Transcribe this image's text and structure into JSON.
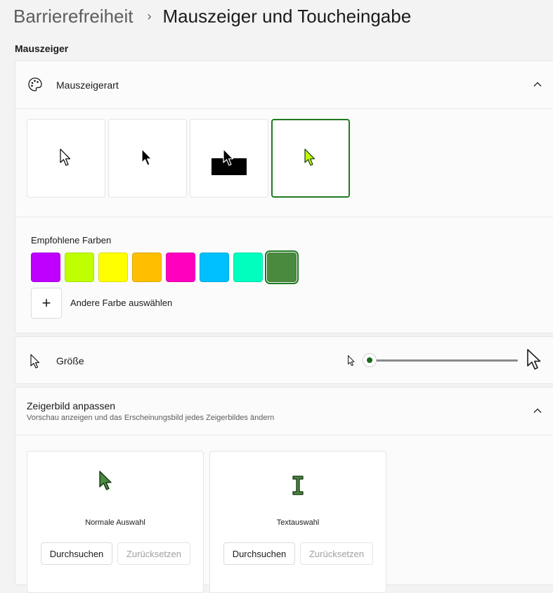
{
  "breadcrumb": {
    "parent": "Barrierefreiheit",
    "separator": "›",
    "current": "Mauszeiger und Toucheingabe"
  },
  "section_label": "Mauszeiger",
  "pointer_style": {
    "label": "Mauszeigerart",
    "options": [
      "white",
      "black",
      "inverted",
      "custom"
    ],
    "selected": "custom"
  },
  "colors": {
    "title": "Empfohlene Farben",
    "swatches": [
      "#bf00ff",
      "#bfff00",
      "#ffff00",
      "#ffbf00",
      "#ff00bf",
      "#00bfff",
      "#00ffbf",
      "#4a8a3f"
    ],
    "selected_index": 7,
    "add_icon": "+",
    "add_label": "Andere Farbe auswählen"
  },
  "size": {
    "label": "Größe",
    "value": 1
  },
  "pointer_image": {
    "title": "Zeigerbild anpassen",
    "subtitle": "Vorschau anzeigen und das Erscheinungsbild jedes Zeigerbildes ändern",
    "cards": [
      {
        "name": "Normale Auswahl",
        "browse": "Durchsuchen",
        "reset": "Zurücksetzen"
      },
      {
        "name": "Textauswahl",
        "browse": "Durchsuchen",
        "reset": "Zurücksetzen"
      }
    ]
  },
  "accent_color": "#1f7a1f"
}
